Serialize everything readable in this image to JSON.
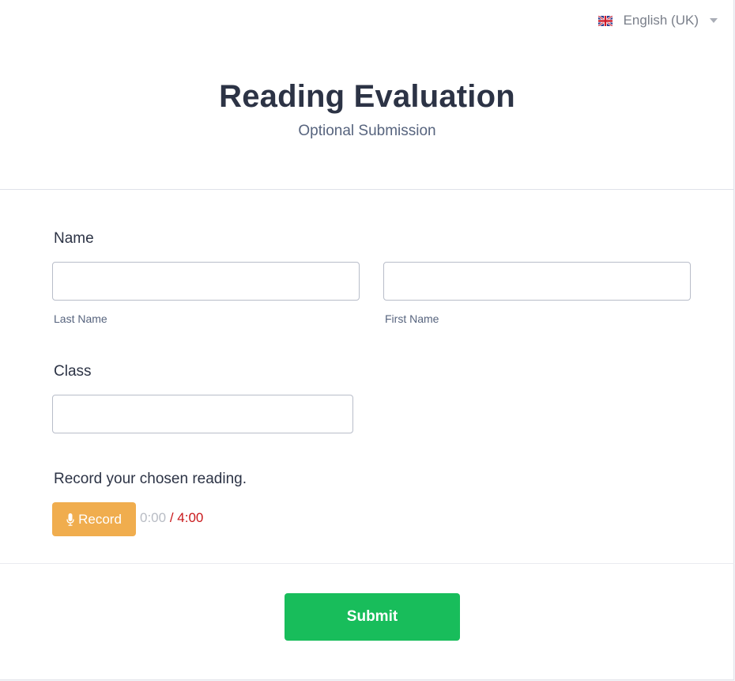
{
  "language": {
    "selected": "English (UK)",
    "flag_icon": "uk-flag-icon"
  },
  "header": {
    "title": "Reading Evaluation",
    "subtitle": "Optional Submission"
  },
  "form": {
    "name": {
      "label": "Name",
      "last_name": {
        "sublabel": "Last Name",
        "value": ""
      },
      "first_name": {
        "sublabel": "First Name",
        "value": ""
      }
    },
    "class": {
      "label": "Class",
      "value": ""
    },
    "recording": {
      "label": "Record your chosen reading.",
      "button_label": "Record",
      "button_icon": "microphone-icon",
      "elapsed": "0:00",
      "limit": "/ 4:00"
    }
  },
  "submit_label": "Submit",
  "colors": {
    "title": "#2c3345",
    "record_button": "#f0ad4e",
    "submit_button": "#18bd5b",
    "timer_limit": "#c9181b"
  }
}
